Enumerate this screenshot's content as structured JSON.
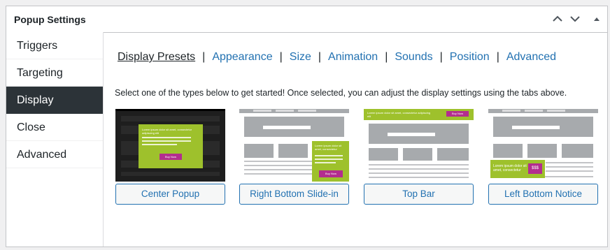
{
  "header": {
    "title": "Popup Settings"
  },
  "sidebar": {
    "items": [
      {
        "label": "Triggers"
      },
      {
        "label": "Targeting"
      },
      {
        "label": "Display"
      },
      {
        "label": "Close"
      },
      {
        "label": "Advanced"
      }
    ],
    "active": "Display"
  },
  "tabs": [
    {
      "label": "Display Presets"
    },
    {
      "label": "Appearance"
    },
    {
      "label": "Size"
    },
    {
      "label": "Animation"
    },
    {
      "label": "Sounds"
    },
    {
      "label": "Position"
    },
    {
      "label": "Advanced"
    }
  ],
  "intro_text": "Select one of the types below to get started! Once selected, you can adjust the display settings using the tabs above.",
  "presets": [
    {
      "label": "Center Popup"
    },
    {
      "label": "Right Bottom Slide-in"
    },
    {
      "label": "Top Bar"
    },
    {
      "label": "Left Bottom Notice"
    }
  ],
  "thumbnails": {
    "center": {
      "text": "Lorem ipsum dolor sit amet, consectetur adipiscing elit",
      "button": "Buy Now"
    },
    "slide": {
      "text": "Lorem ipsum dolor sit amet, consectetur",
      "button": "Buy Now"
    },
    "topbar": {
      "text": "Lorem ipsum dolor sit amet, consectetur adipiscing elit",
      "button": "Buy Now"
    },
    "notice": {
      "text": "Lorem ipsum dolor sit amet, consectetur",
      "button": "$$$"
    }
  },
  "colors": {
    "accent": "#2271b1",
    "active_bg": "#2c3338",
    "preview_green": "#9ec12c",
    "preview_magenta": "#b32d8e"
  },
  "icons": [
    "chevron-up-icon",
    "chevron-down-icon",
    "triangle-up-icon"
  ]
}
